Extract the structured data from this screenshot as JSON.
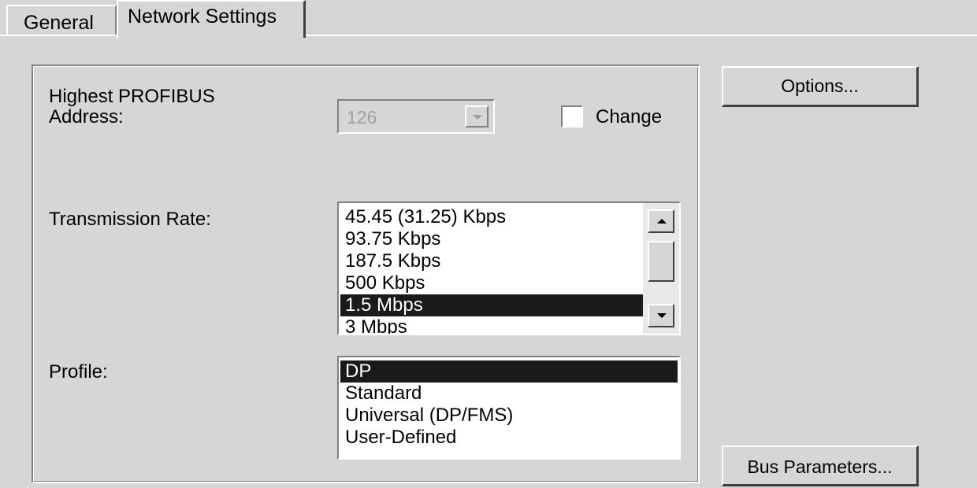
{
  "tabs": {
    "general": "General",
    "network_settings": "Network Settings"
  },
  "network": {
    "highest_address_label": "Highest PROFIBUS\nAddress:",
    "highest_address_value": "126",
    "change_label": "Change",
    "change_checked": false,
    "transmission_rate_label": "Transmission Rate:",
    "transmission_rates": [
      "45.45 (31.25) Kbps",
      "93.75 Kbps",
      "187.5 Kbps",
      "500 Kbps",
      "1.5 Mbps",
      "3 Mbps"
    ],
    "selected_rate": "1.5 Mbps",
    "profile_label": "Profile:",
    "profiles": [
      "DP",
      "Standard",
      "Universal (DP/FMS)",
      "User-Defined"
    ],
    "selected_profile": "DP"
  },
  "buttons": {
    "options": "Options...",
    "bus_parameters": "Bus Parameters..."
  }
}
